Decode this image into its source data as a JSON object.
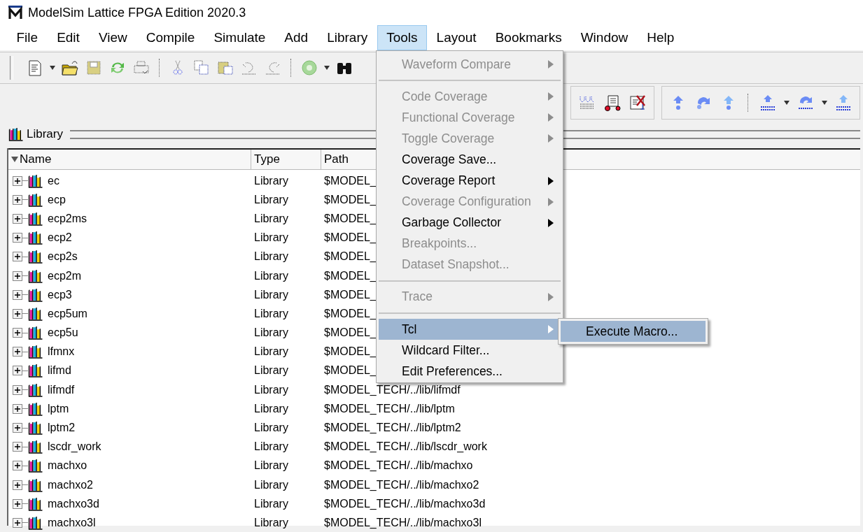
{
  "window": {
    "title": "ModelSim Lattice FPGA Edition 2020.3"
  },
  "menu_bar": [
    {
      "label": "File",
      "selected": false
    },
    {
      "label": "Edit",
      "selected": false
    },
    {
      "label": "View",
      "selected": false
    },
    {
      "label": "Compile",
      "selected": false
    },
    {
      "label": "Simulate",
      "selected": false
    },
    {
      "label": "Add",
      "selected": false
    },
    {
      "label": "Library",
      "selected": false
    },
    {
      "label": "Tools",
      "selected": true
    },
    {
      "label": "Layout",
      "selected": false
    },
    {
      "label": "Bookmarks",
      "selected": false
    },
    {
      "label": "Window",
      "selected": false
    },
    {
      "label": "Help",
      "selected": false
    }
  ],
  "library_pane": {
    "title": "Library",
    "columns": [
      "Name",
      "Type",
      "Path"
    ],
    "rows": [
      {
        "name": "ec",
        "type": "Library",
        "path": "$MODEL_"
      },
      {
        "name": "ecp",
        "type": "Library",
        "path": "$MODEL_"
      },
      {
        "name": "ecp2ms",
        "type": "Library",
        "path": "$MODEL_"
      },
      {
        "name": "ecp2",
        "type": "Library",
        "path": "$MODEL_"
      },
      {
        "name": "ecp2s",
        "type": "Library",
        "path": "$MODEL_"
      },
      {
        "name": "ecp2m",
        "type": "Library",
        "path": "$MODEL_"
      },
      {
        "name": "ecp3",
        "type": "Library",
        "path": "$MODEL_"
      },
      {
        "name": "ecp5um",
        "type": "Library",
        "path": "$MODEL_"
      },
      {
        "name": "ecp5u",
        "type": "Library",
        "path": "$MODEL_"
      },
      {
        "name": "lfmnx",
        "type": "Library",
        "path": "$MODEL_"
      },
      {
        "name": "lifmd",
        "type": "Library",
        "path": "$MODEL_"
      },
      {
        "name": "lifmdf",
        "type": "Library",
        "path": "$MODEL_TECH/../lib/lifmdf"
      },
      {
        "name": "lptm",
        "type": "Library",
        "path": "$MODEL_TECH/../lib/lptm"
      },
      {
        "name": "lptm2",
        "type": "Library",
        "path": "$MODEL_TECH/../lib/lptm2"
      },
      {
        "name": "lscdr_work",
        "type": "Library",
        "path": "$MODEL_TECH/../lib/lscdr_work"
      },
      {
        "name": "machxo",
        "type": "Library",
        "path": "$MODEL_TECH/../lib/machxo"
      },
      {
        "name": "machxo2",
        "type": "Library",
        "path": "$MODEL_TECH/../lib/machxo2"
      },
      {
        "name": "machxo3d",
        "type": "Library",
        "path": "$MODEL_TECH/../lib/machxo3d"
      },
      {
        "name": "machxo3l",
        "type": "Library",
        "path": "$MODEL_TECH/../lib/machxo3l"
      }
    ]
  },
  "tools_menu": {
    "items": [
      {
        "kind": "item",
        "label": "Waveform Compare",
        "disabled": true,
        "submenu": true,
        "selected": false
      },
      {
        "kind": "separator"
      },
      {
        "kind": "item",
        "label": "Code Coverage",
        "disabled": true,
        "submenu": true,
        "selected": false
      },
      {
        "kind": "item",
        "label": "Functional Coverage",
        "disabled": true,
        "submenu": true,
        "selected": false
      },
      {
        "kind": "item",
        "label": "Toggle Coverage",
        "disabled": true,
        "submenu": true,
        "selected": false
      },
      {
        "kind": "item",
        "label": "Coverage Save...",
        "disabled": false,
        "submenu": false,
        "selected": false
      },
      {
        "kind": "item",
        "label": "Coverage Report",
        "disabled": false,
        "submenu": true,
        "selected": false
      },
      {
        "kind": "item",
        "label": "Coverage Configuration",
        "disabled": true,
        "submenu": true,
        "selected": false
      },
      {
        "kind": "item",
        "label": "Garbage Collector",
        "disabled": false,
        "submenu": true,
        "selected": false
      },
      {
        "kind": "item",
        "label": "Breakpoints...",
        "disabled": true,
        "submenu": false,
        "selected": false
      },
      {
        "kind": "item",
        "label": "Dataset Snapshot...",
        "disabled": true,
        "submenu": false,
        "selected": false
      },
      {
        "kind": "separator"
      },
      {
        "kind": "item",
        "label": "Trace",
        "disabled": true,
        "submenu": true,
        "selected": false
      },
      {
        "kind": "separator"
      },
      {
        "kind": "item",
        "label": "Tcl",
        "disabled": false,
        "submenu": true,
        "selected": true
      },
      {
        "kind": "item",
        "label": "Wildcard Filter...",
        "disabled": false,
        "submenu": false,
        "selected": false
      },
      {
        "kind": "item",
        "label": "Edit Preferences...",
        "disabled": false,
        "submenu": false,
        "selected": false
      }
    ]
  },
  "tcl_submenu": {
    "items": [
      {
        "label": "Execute Macro...",
        "selected": true
      }
    ]
  }
}
